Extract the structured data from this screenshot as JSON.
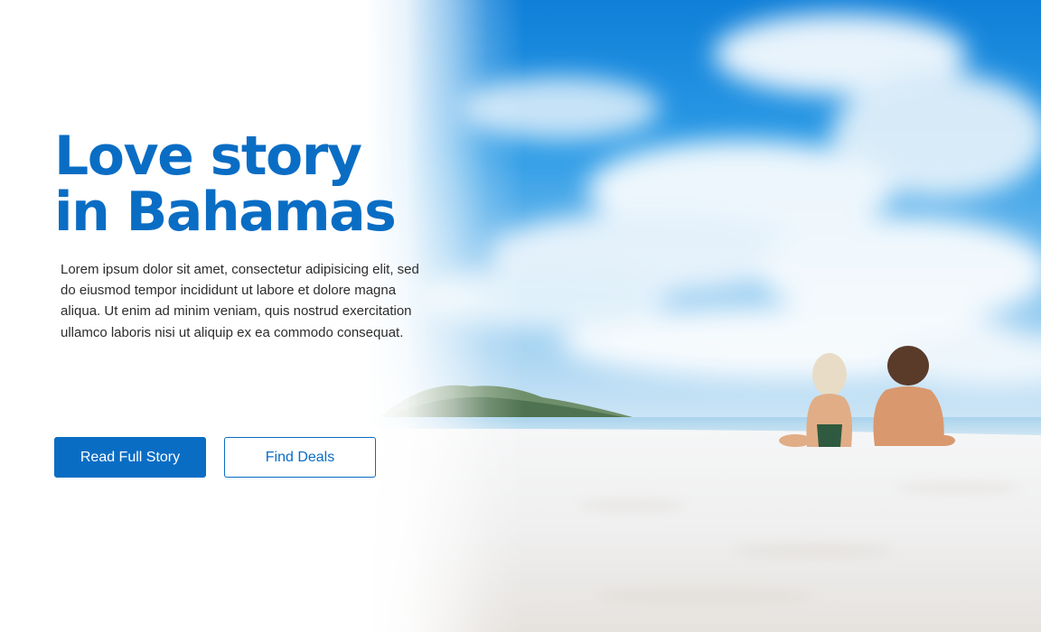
{
  "hero": {
    "headline_line1": "Love story",
    "headline_line2": "in Bahamas",
    "description": "Lorem ipsum dolor sit amet, consectetur adipisicing elit, sed do eiusmod tempor incididunt ut labore et dolore magna aliqua. Ut enim ad minim veniam, quis nostrud exercitation ullamco laboris nisi ut aliquip ex ea commodo consequat."
  },
  "buttons": {
    "primary_label": "Read Full Story",
    "secondary_label": "Find Deals"
  },
  "colors": {
    "brand_blue": "#0a6dc4",
    "sky_blue": "#1e8ee0",
    "sand": "#f2f3f3"
  }
}
